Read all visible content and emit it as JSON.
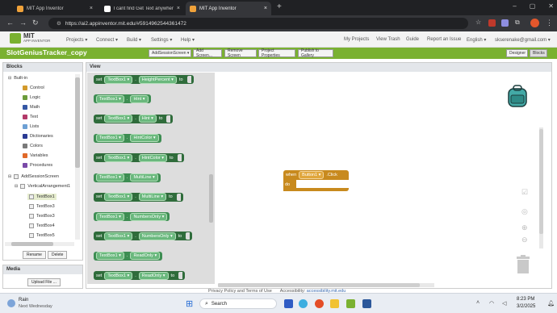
{
  "browser": {
    "tabs": [
      {
        "title": "MIT App Inventor",
        "active": false
      },
      {
        "title": "I cant find Get Text anywhere -",
        "active": false
      },
      {
        "title": "MIT App Inventor",
        "active": true
      }
    ],
    "new_tab": "+",
    "url": "https://ai2.appinventor.mit.edu/#5914962544361472"
  },
  "app_header": {
    "logo_top": "MIT",
    "logo_bottom": "APP INVENTOR",
    "menu": [
      "Projects",
      "Connect",
      "Build",
      "Settings",
      "Help"
    ],
    "right_links": [
      "My Projects",
      "View Trash",
      "Guide",
      "Report an Issue",
      "English"
    ],
    "user": "skserenake@gmail.com"
  },
  "project": {
    "name": "SlotGeniusTracker_copy",
    "buttons": [
      "AddSessionScreen",
      "Add Screen...",
      "Remove Screen",
      "Project Properties",
      "Publish to Gallery"
    ],
    "designer": "Designer",
    "blocks": "Blocks"
  },
  "blocks_panel": {
    "title": "Blocks",
    "builtin": "Built-in",
    "categories": [
      {
        "label": "Control",
        "color": "#d39a2b"
      },
      {
        "label": "Logic",
        "color": "#6c9c3b"
      },
      {
        "label": "Math",
        "color": "#3457a4"
      },
      {
        "label": "Text",
        "color": "#b33a6a"
      },
      {
        "label": "Lists",
        "color": "#6da0d4"
      },
      {
        "label": "Dictionaries",
        "color": "#2a3a93"
      },
      {
        "label": "Colors",
        "color": "#7a7a7a"
      },
      {
        "label": "Variables",
        "color": "#e0692a"
      },
      {
        "label": "Procedures",
        "color": "#7a4aa8"
      }
    ],
    "screen": "AddSessionScreen",
    "arrangement": "VerticalArrangement1",
    "components": [
      "TextBox1",
      "TextBox3",
      "TextBox3",
      "TextBox4",
      "TextBox5"
    ],
    "rename": "Rename",
    "delete": "Delete"
  },
  "media_panel": {
    "title": "Media",
    "upload": "Upload File ..."
  },
  "view_panel": {
    "title": "View"
  },
  "flyout": {
    "component": "TextBox1",
    "blocks": [
      {
        "kind": "set",
        "prop": "HeightPercent",
        "tail": "to"
      },
      {
        "kind": "get",
        "prop": "Hint",
        "tail": ""
      },
      {
        "kind": "set",
        "prop": "Hint",
        "tail": "to"
      },
      {
        "kind": "get",
        "prop": "HintColor",
        "tail": ""
      },
      {
        "kind": "set",
        "prop": "HintColor",
        "tail": "to"
      },
      {
        "kind": "get",
        "prop": "MultiLine",
        "tail": ""
      },
      {
        "kind": "set",
        "prop": "MultiLine",
        "tail": "to"
      },
      {
        "kind": "get",
        "prop": "NumbersOnly",
        "tail": ""
      },
      {
        "kind": "set",
        "prop": "NumbersOnly",
        "tail": "to"
      },
      {
        "kind": "get",
        "prop": "ReadOnly",
        "tail": ""
      },
      {
        "kind": "set",
        "prop": "ReadOnly",
        "tail": "to"
      }
    ],
    "set_word": "set",
    "dot": "."
  },
  "event_block": {
    "when": "when",
    "component": "Button1",
    "event": ".Click",
    "do": "do"
  },
  "footer": {
    "privacy": "Privacy Policy and Terms of Use",
    "accessibility": "Accessibility:",
    "accessibility_link": "accessibility.mit.edu"
  },
  "taskbar": {
    "weather": "Rain",
    "weather_sub": "Next Wednesday",
    "search": "Search",
    "time": "8:23 PM",
    "date": "3/2/2025"
  }
}
